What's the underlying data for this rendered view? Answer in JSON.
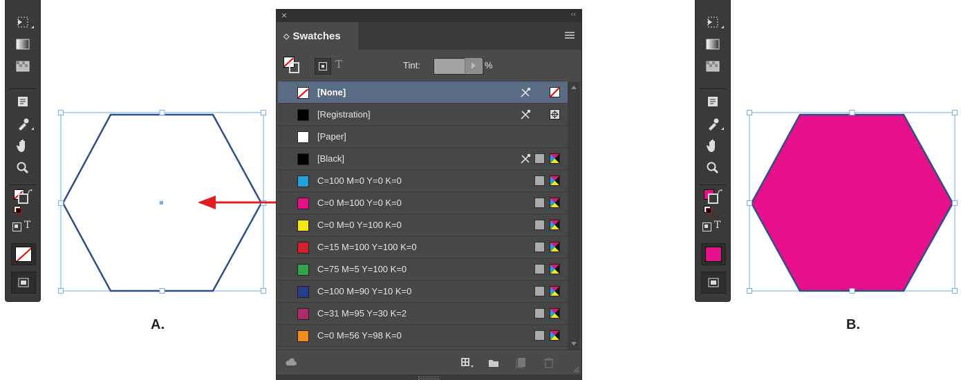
{
  "panel": {
    "close_glyph": "×",
    "collapse_glyph": "‹‹",
    "tab_label": "Swatches",
    "tab_arrow": "◇",
    "tint_label": "Tint:",
    "tint_percent": "%",
    "tint_value": "",
    "type_glyph": "T",
    "swatches": [
      {
        "name": "[None]",
        "color": "none",
        "selected": true,
        "icons": [
          "no-edit",
          "none-mode"
        ]
      },
      {
        "name": "[Registration]",
        "color": "#000000",
        "selected": false,
        "icons": [
          "no-edit",
          "registration"
        ]
      },
      {
        "name": "[Paper]",
        "color": "#ffffff",
        "selected": false,
        "icons": []
      },
      {
        "name": "[Black]",
        "color": "#000000",
        "selected": false,
        "icons": [
          "no-edit",
          "process",
          "cmyk"
        ]
      },
      {
        "name": "C=100 M=0 Y=0 K=0",
        "color": "#1fa2dd",
        "selected": false,
        "icons": [
          "process",
          "cmyk"
        ]
      },
      {
        "name": "C=0 M=100 Y=0 K=0",
        "color": "#e8108a",
        "selected": false,
        "icons": [
          "process",
          "cmyk"
        ]
      },
      {
        "name": "C=0 M=0 Y=100 K=0",
        "color": "#f5e60f",
        "selected": false,
        "icons": [
          "process",
          "cmyk"
        ]
      },
      {
        "name": "C=15 M=100 Y=100 K=0",
        "color": "#d4202a",
        "selected": false,
        "icons": [
          "process",
          "cmyk"
        ]
      },
      {
        "name": "C=75 M=5 Y=100 K=0",
        "color": "#2ea64a",
        "selected": false,
        "icons": [
          "process",
          "cmyk"
        ]
      },
      {
        "name": "C=100 M=90 Y=10 K=0",
        "color": "#273c8e",
        "selected": false,
        "icons": [
          "process",
          "cmyk"
        ]
      },
      {
        "name": "C=31 M=95 Y=30 K=2",
        "color": "#b22a6e",
        "selected": false,
        "icons": [
          "process",
          "cmyk"
        ]
      },
      {
        "name": "C=0 M=56 Y=98 K=0",
        "color": "#f28a1d",
        "selected": false,
        "icons": [
          "process",
          "cmyk"
        ]
      }
    ]
  },
  "figure": {
    "label_a": "A.",
    "label_b": "B.",
    "hexagon_stroke": "#2c4f86",
    "hexagon_fill_b": "#e8108a",
    "selection_color": "#6fb0e8",
    "arrow_color": "#e02020"
  },
  "toolbar_left": {
    "type_glyph": "T",
    "fill": "none"
  },
  "toolbar_right": {
    "type_glyph": "T",
    "fill": "#e8108a"
  }
}
